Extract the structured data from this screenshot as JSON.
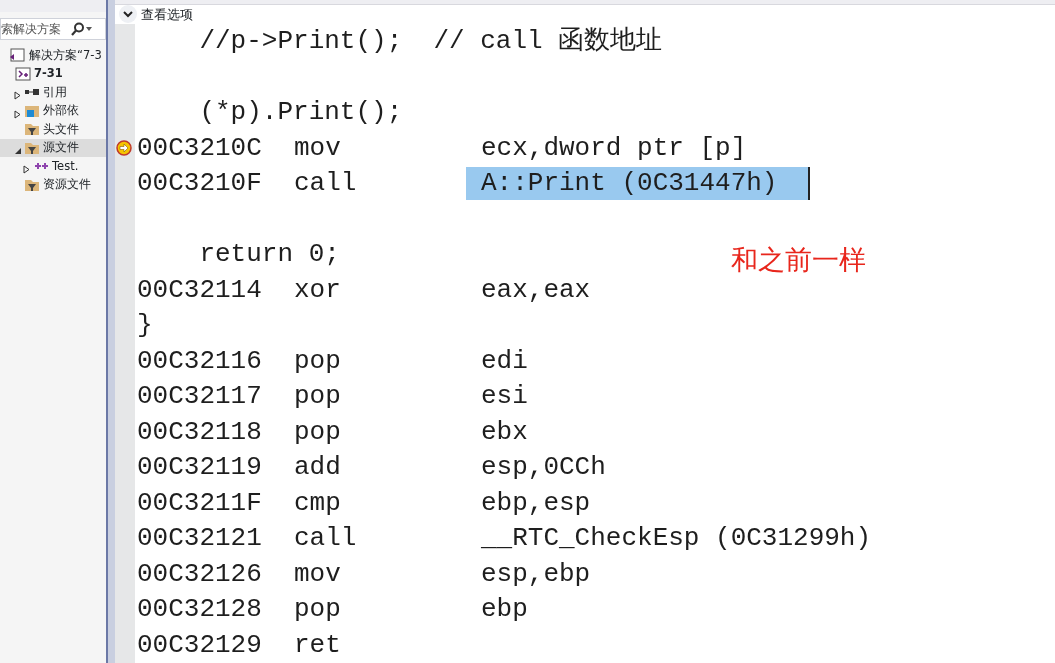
{
  "solution_explorer": {
    "search": {
      "value": "索解决方案"
    },
    "tree": [
      {
        "label": "解决方案“7-3",
        "kind": "solution",
        "selected": false,
        "children": [
          {
            "label": "7-31",
            "kind": "project",
            "selected": false,
            "children": [
              {
                "label": "引用",
                "kind": "references",
                "expanded": false,
                "selected": false
              },
              {
                "label": "外部依",
                "kind": "external",
                "expanded": false,
                "selected": false
              },
              {
                "label": "头文件",
                "kind": "folder",
                "selected": false
              },
              {
                "label": "源文件",
                "kind": "folder",
                "expanded": true,
                "selected": true,
                "children": [
                  {
                    "label": "Test.",
                    "kind": "cpp",
                    "expanded": false,
                    "selected": false
                  }
                ]
              },
              {
                "label": "资源文件",
                "kind": "folder",
                "selected": false
              }
            ]
          }
        ]
      }
    ]
  },
  "editor": {
    "view_options": {
      "label": "查看选项"
    },
    "lines": [
      {
        "kind": "source",
        "text": "    //p->Print();  // call 函数地址"
      },
      {
        "kind": "blank"
      },
      {
        "kind": "source",
        "text": "    (*p).Print();"
      },
      {
        "kind": "asm",
        "address": "00C3210C",
        "mnemonic": "mov",
        "operand": "ecx,dword ptr [p]",
        "current": true,
        "selected": false
      },
      {
        "kind": "asm",
        "address": "00C3210F",
        "mnemonic": "call",
        "operand": "A::Print (0C31447h)",
        "current": false,
        "selected": true
      },
      {
        "kind": "blank"
      },
      {
        "kind": "source",
        "text": "    return 0;"
      },
      {
        "kind": "asm",
        "address": "00C32114",
        "mnemonic": "xor",
        "operand": "eax,eax",
        "current": false,
        "selected": false
      },
      {
        "kind": "source",
        "text": "}"
      },
      {
        "kind": "asm",
        "address": "00C32116",
        "mnemonic": "pop",
        "operand": "edi",
        "current": false,
        "selected": false
      },
      {
        "kind": "asm",
        "address": "00C32117",
        "mnemonic": "pop",
        "operand": "esi",
        "current": false,
        "selected": false
      },
      {
        "kind": "asm",
        "address": "00C32118",
        "mnemonic": "pop",
        "operand": "ebx",
        "current": false,
        "selected": false
      },
      {
        "kind": "asm",
        "address": "00C32119",
        "mnemonic": "add",
        "operand": "esp,0CCh",
        "current": false,
        "selected": false
      },
      {
        "kind": "asm",
        "address": "00C3211F",
        "mnemonic": "cmp",
        "operand": "ebp,esp",
        "current": false,
        "selected": false
      },
      {
        "kind": "asm",
        "address": "00C32121",
        "mnemonic": "call",
        "operand": "__RTC_CheckEsp (0C31299h)",
        "current": false,
        "selected": false
      },
      {
        "kind": "asm",
        "address": "00C32126",
        "mnemonic": "mov",
        "operand": "esp,ebp",
        "current": false,
        "selected": false
      },
      {
        "kind": "asm",
        "address": "00C32128",
        "mnemonic": "pop",
        "operand": "ebp",
        "current": false,
        "selected": false
      },
      {
        "kind": "asm",
        "address": "00C32129",
        "mnemonic": "ret",
        "current": false,
        "selected": false
      }
    ]
  },
  "annotation": {
    "text": "和之前一样"
  }
}
